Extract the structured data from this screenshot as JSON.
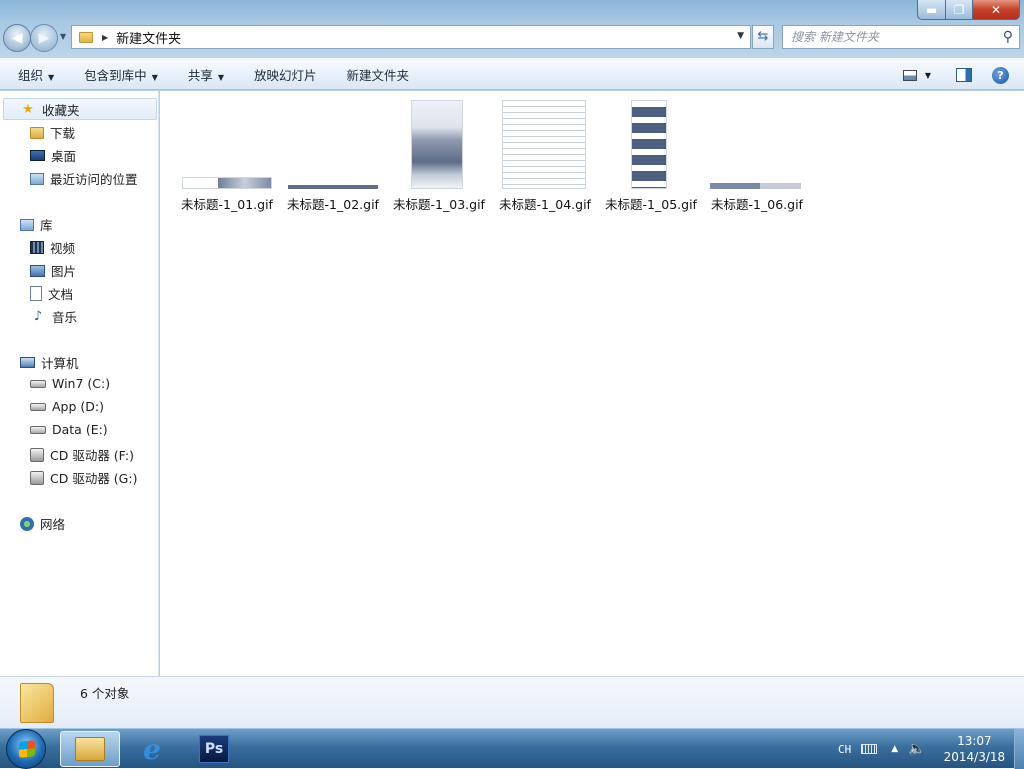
{
  "window": {
    "address_path": "新建文件夹",
    "search_placeholder": "搜索 新建文件夹",
    "controls": {
      "minimize": "▬",
      "maximize": "❐",
      "close": "✕"
    }
  },
  "toolbar": {
    "organize": "组织",
    "include_in_library": "包含到库中",
    "share": "共享",
    "slideshow": "放映幻灯片",
    "new_folder": "新建文件夹"
  },
  "nav": {
    "favorites": {
      "label": "收藏夹",
      "items": [
        "下载",
        "桌面",
        "最近访问的位置"
      ]
    },
    "libraries": {
      "label": "库",
      "items": [
        "视频",
        "图片",
        "文档",
        "音乐"
      ]
    },
    "computer": {
      "label": "计算机",
      "items": [
        "Win7 (C:)",
        "App (D:)",
        "Data (E:)",
        "CD 驱动器 (F:)",
        "CD 驱动器 (G:)"
      ]
    },
    "network": {
      "label": "网络"
    }
  },
  "files": [
    {
      "name": "未标题-1_01.gif"
    },
    {
      "name": "未标题-1_02.gif"
    },
    {
      "name": "未标题-1_03.gif"
    },
    {
      "name": "未标题-1_04.gif"
    },
    {
      "name": "未标题-1_05.gif"
    },
    {
      "name": "未标题-1_06.gif"
    }
  ],
  "status": {
    "count": "6 个对象"
  },
  "taskbar": {
    "ps_label": "Ps",
    "ie_label": "e",
    "lang": "CH",
    "time": "13:07",
    "date": "2014/3/18"
  },
  "colors": {
    "accent": "#3a6f9e",
    "selection": "#e2eefa",
    "close": "#c4422a"
  }
}
